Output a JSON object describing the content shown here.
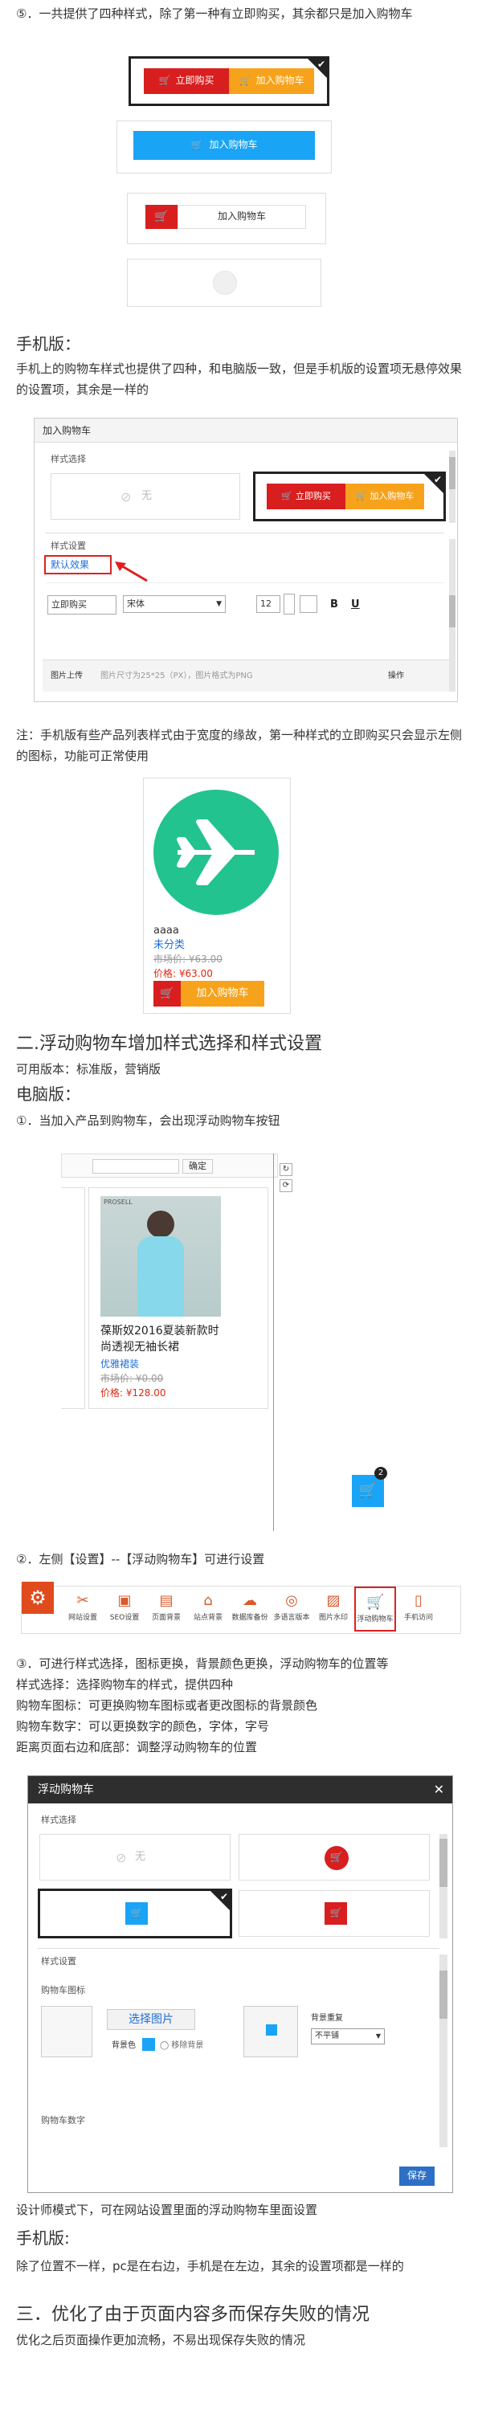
{
  "section1": {
    "intro": "⑤．一共提供了四种样式，除了第一种有立即购买，其余都只是加入购物车",
    "style1": {
      "buy_now": "立即购买",
      "add_cart": "加入购物车"
    },
    "style2": {
      "add_cart": "加入购物车"
    },
    "style3": {
      "add_cart": "加入购物车"
    }
  },
  "mobile": {
    "heading": "手机版：",
    "desc": "手机上的购物车样式也提供了四种，和电脑版一致，但是手机版的设置项无悬停效果的设置项，其余是一样的",
    "panel": {
      "title": "加入购物车",
      "style_select": "样式选择",
      "none_label": "无",
      "buy_now": "立即购买",
      "add_cart": "加入购物车",
      "style_settings": "样式设置",
      "default_effect": "默认效果",
      "button_text": "立即购买",
      "font": "宋体",
      "size": "12",
      "bold": "B",
      "underline": "U",
      "image_upload": "图片上传",
      "image_hint": "图片尺寸为25*25（PX），图片格式为PNG",
      "operation": "操作"
    },
    "note": "注：手机版有些产品列表样式由于宽度的缘故，第一种样式的立即购买只会显示左侧的图标，功能可正常使用",
    "product": {
      "name": "aaaa",
      "category": "未分类",
      "market_price": "市场价: ¥63.00",
      "price": "价格: ¥63.00",
      "add_cart": "加入购物车"
    }
  },
  "section2": {
    "title": "二.浮动购物车增加样式选择和样式设置",
    "versions": "可用版本：标准版，营销版",
    "pc_heading": "电脑版：",
    "step1": "①．当加入产品到购物车，会出现浮动购物车按钮",
    "confirm": "确定",
    "product": {
      "brand": "PROSELL",
      "name": "葆斯奴2016夏装新款时尚透视无袖长裙",
      "cat": "优雅裙装",
      "market": "市场价: ¥0.00",
      "price": "价格: ¥128.00"
    },
    "badge": "2",
    "step2": "②．左侧【设置】--【浮动购物车】可进行设置",
    "tools": [
      "网站设置",
      "SEO设置",
      "页面背景",
      "站点背景",
      "数据库备份",
      "多语言版本",
      "图片水印",
      "浮动购物车",
      "手机访问"
    ],
    "step3_lines": [
      "③．可进行样式选择，图标更换，背景颜色更换，浮动购物车的位置等",
      "样式选择：选择购物车的样式，提供四种",
      "购物车图标：可更换购物车图标或者更改图标的背景颜色",
      "购物车数字：可以更换数字的颜色，字体，字号",
      "距离页面右边和底部：调整浮动购物车的位置"
    ],
    "float_panel": {
      "title": "浮动购物车",
      "style_select": "样式选择",
      "none_label": "无",
      "style_settings": "样式设置",
      "cart_icon": "购物车图标",
      "choose_image": "选择图片",
      "bg_color": "背景色",
      "remove_bg": "移除背景",
      "bg_repeat": "背景重复",
      "no_repeat": "不平铺",
      "cart_number": "购物车数字",
      "save": "保存"
    },
    "designer_note": "设计师模式下，可在网站设置里面的浮动购物车里面设置",
    "mobile_heading": "手机版:",
    "mobile_desc": "除了位置不一样，pc是在右边，手机是在左边，其余的设置项都是一样的"
  },
  "section3": {
    "title": "三．优化了由于页面内容多而保存失败的情况",
    "desc": "优化之后页面操作更加流畅，不易出现保存失败的情况"
  },
  "colors": {
    "red": "#d81e1e",
    "orange": "#f7a21b",
    "blue": "#1aa4f5",
    "green": "#22c38e",
    "dark": "#2e2e2e",
    "link": "#1e6fd9"
  }
}
